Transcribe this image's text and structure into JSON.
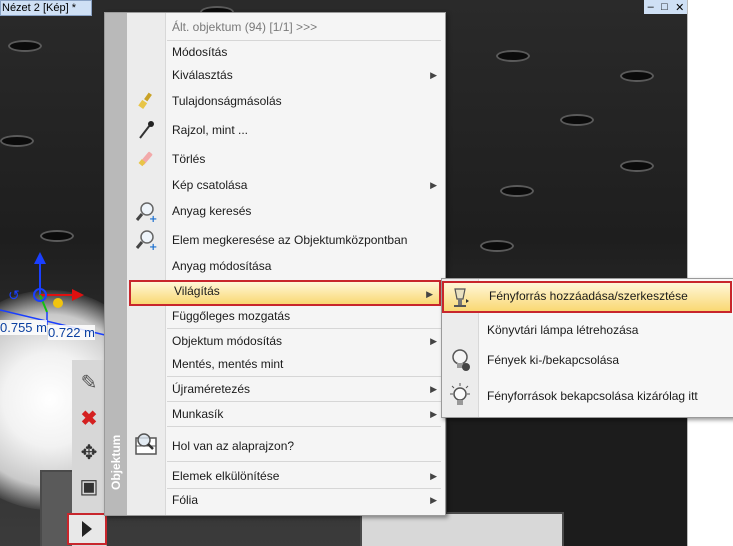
{
  "window": {
    "title": "Nézet 2 [Kép] *",
    "controls": [
      "–",
      "□",
      "✕"
    ]
  },
  "dimensions": {
    "dim1": "0.755 m",
    "dim2": "0.722 m"
  },
  "context_menu": {
    "side_label": "Objektum",
    "header": "Ált. objektum (94) [1/1] >>>",
    "items": [
      {
        "label": "Módosítás",
        "icon": "",
        "submenu": false
      },
      {
        "label": "Kiválasztás",
        "icon": "",
        "submenu": true
      },
      {
        "label": "Tulajdonságmásolás",
        "icon": "paintbrush-icon",
        "submenu": false
      },
      {
        "label": "Rajzol, mint ...",
        "icon": "pipette-icon",
        "submenu": false
      },
      {
        "label": "Törlés",
        "icon": "eraser-icon",
        "submenu": false
      },
      {
        "label": "Kép csatolása",
        "icon": "",
        "submenu": true
      },
      {
        "label": "Anyag keresés",
        "icon": "magnifier-plus-icon",
        "submenu": false
      },
      {
        "label": "Elem megkeresése az Objektumközpontban",
        "icon": "magnifier-plus-icon",
        "submenu": false
      },
      {
        "label": "Anyag módosítása",
        "icon": "",
        "submenu": false
      },
      {
        "label": "Világítás",
        "icon": "",
        "submenu": true
      },
      {
        "label": "Függőleges mozgatás",
        "icon": "",
        "submenu": false
      },
      {
        "label": "Objektum módosítás",
        "icon": "",
        "submenu": true
      },
      {
        "label": "Mentés, mentés mint",
        "icon": "",
        "submenu": false
      },
      {
        "label": "Újraméretezés",
        "icon": "",
        "submenu": true
      },
      {
        "label": "Munkasík",
        "icon": "",
        "submenu": true
      },
      {
        "label": "Hol van az alaprajzon?",
        "icon": "floorplan-search-icon",
        "submenu": false
      },
      {
        "label": "Elemek elkülönítése",
        "icon": "",
        "submenu": true
      },
      {
        "label": "Fólia",
        "icon": "",
        "submenu": true
      }
    ]
  },
  "submenu": {
    "items": [
      {
        "label": "Fényforrás hozzáadása/szerkesztése",
        "icon": "lamp-edit-icon"
      },
      {
        "label": "Könyvtári lámpa létrehozása",
        "icon": ""
      },
      {
        "label": "Fények ki-/bekapcsolása",
        "icon": "bulb-toggle-icon"
      },
      {
        "label": "Fényforrások bekapcsolása kizárólag itt",
        "icon": "bulb-rays-icon"
      }
    ]
  },
  "colors": {
    "highlight_border": "#c8262c",
    "highlight_fill": "#f9d873",
    "menu_side": "#b9b9b9"
  }
}
